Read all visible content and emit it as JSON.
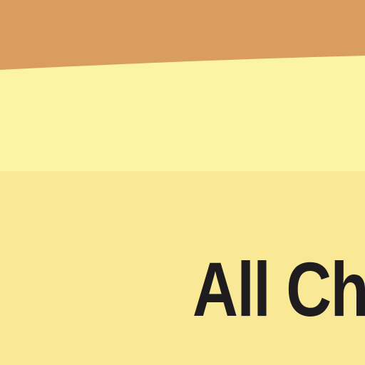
{
  "colors": {
    "header_band": "#d99d62",
    "light_band": "#fbf3a6",
    "panel_background": "#f9e896",
    "text": "#1e1c1f"
  },
  "section": {
    "title": "All Ch"
  }
}
